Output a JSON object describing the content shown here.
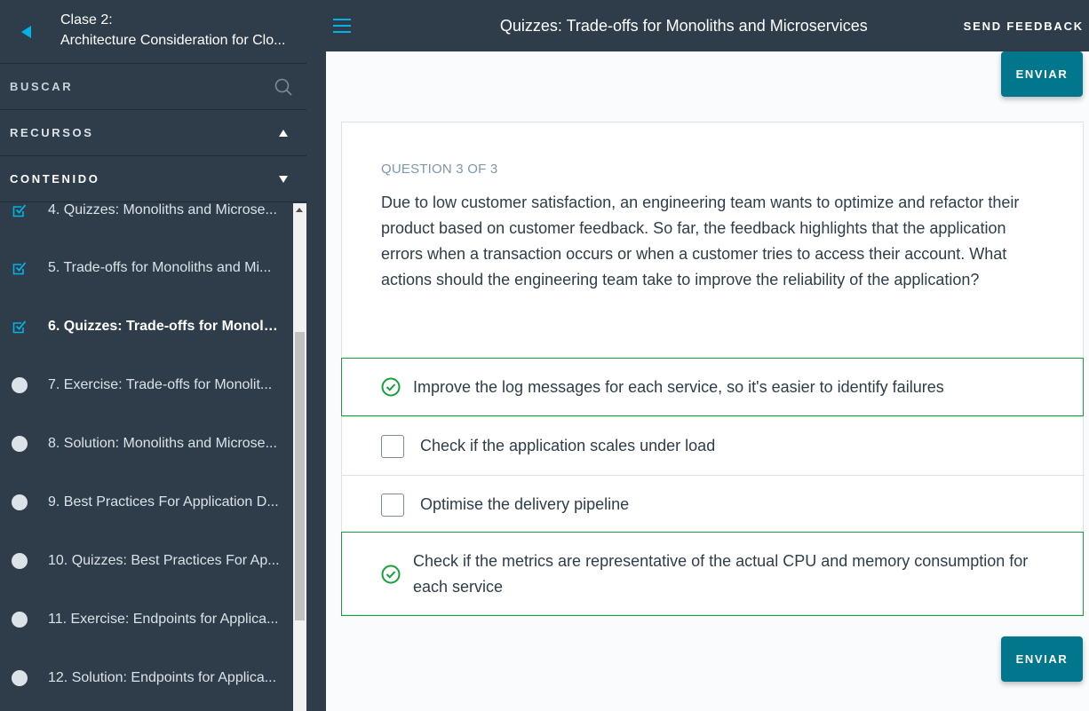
{
  "sidebar": {
    "lesson_number": "Clase 2:",
    "lesson_title": "Architecture Consideration for Clo...",
    "search_label": "BUSCAR",
    "resources_label": "RECURSOS",
    "content_label": "CONTENIDO",
    "items": [
      {
        "label": "4. Quizzes: Monoliths and Microse...",
        "status": "completed"
      },
      {
        "label": "5. Trade-offs for Monoliths and Mi...",
        "status": "completed"
      },
      {
        "label": "6. Quizzes: Trade-offs for Monolit...",
        "status": "completed-active"
      },
      {
        "label": "7. Exercise: Trade-offs for Monolit...",
        "status": "pending"
      },
      {
        "label": "8. Solution: Monoliths and Microse...",
        "status": "pending"
      },
      {
        "label": "9. Best Practices For Application D...",
        "status": "pending"
      },
      {
        "label": "10. Quizzes: Best Practices For Ap...",
        "status": "pending"
      },
      {
        "label": "11. Exercise: Endpoints for Applica...",
        "status": "pending"
      },
      {
        "label": "12. Solution: Endpoints for Applica...",
        "status": "pending"
      }
    ]
  },
  "topbar": {
    "title": "Quizzes: Trade-offs for Monoliths and Microservices",
    "feedback_label": "SEND FEEDBACK"
  },
  "quiz": {
    "submit_label": "ENVIAR",
    "question_number": "QUESTION 3 OF 3",
    "question_text": "Due to low customer satisfaction, an engineering team wants to optimize and refactor their product based on customer feedback. So far, the feedback highlights that the application errors when a transaction occurs or when a customer tries to access their account. What actions should the engineering team take to improve the reliability of the application?",
    "options": [
      {
        "text": "Improve the log messages for each service, so it's easier to identify failures",
        "checked": true
      },
      {
        "text": "Check if the application scales under load",
        "checked": false
      },
      {
        "text": "Optimise the delivery pipeline",
        "checked": false
      },
      {
        "text": "Check if the metrics are representative of the actual CPU and memory consumption for each service",
        "checked": true
      }
    ]
  },
  "colors": {
    "sidebar_bg": "#2e3d49",
    "accent": "#02b3e4",
    "button": "#02768d",
    "correct": "#15a03b"
  }
}
